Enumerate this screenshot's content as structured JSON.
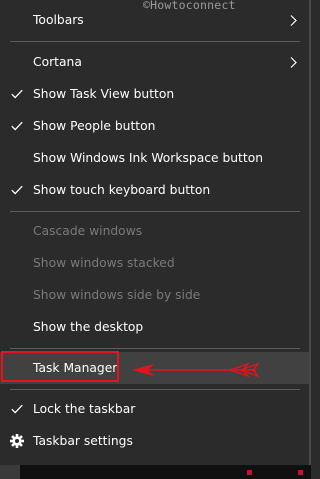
{
  "watermark": "©Howtoconnect",
  "menu": {
    "items": [
      {
        "label": "Toolbars",
        "checked": false,
        "submenu": true,
        "disabled": false
      },
      {
        "label": "Cortana",
        "checked": false,
        "submenu": true,
        "disabled": false
      },
      {
        "label": "Show Task View button",
        "checked": true,
        "submenu": false,
        "disabled": false
      },
      {
        "label": "Show People button",
        "checked": true,
        "submenu": false,
        "disabled": false
      },
      {
        "label": "Show Windows Ink Workspace button",
        "checked": false,
        "submenu": false,
        "disabled": false
      },
      {
        "label": "Show touch keyboard button",
        "checked": true,
        "submenu": false,
        "disabled": false
      },
      {
        "label": "Cascade windows",
        "checked": false,
        "submenu": false,
        "disabled": true
      },
      {
        "label": "Show windows stacked",
        "checked": false,
        "submenu": false,
        "disabled": true
      },
      {
        "label": "Show windows side by side",
        "checked": false,
        "submenu": false,
        "disabled": true
      },
      {
        "label": "Show the desktop",
        "checked": false,
        "submenu": false,
        "disabled": false
      },
      {
        "label": "Task Manager",
        "checked": false,
        "submenu": false,
        "disabled": false,
        "highlighted": true
      },
      {
        "label": "Lock the taskbar",
        "checked": true,
        "submenu": false,
        "disabled": false
      },
      {
        "label": "Taskbar settings",
        "checked": false,
        "submenu": false,
        "disabled": false,
        "icon": "gear-icon"
      }
    ]
  },
  "colors": {
    "menu_background": "#2b2b2b",
    "text": "#ffffff",
    "disabled_text": "#7a7a7a",
    "separator": "#5c5c5c",
    "annotation_red": "#e3141b"
  }
}
